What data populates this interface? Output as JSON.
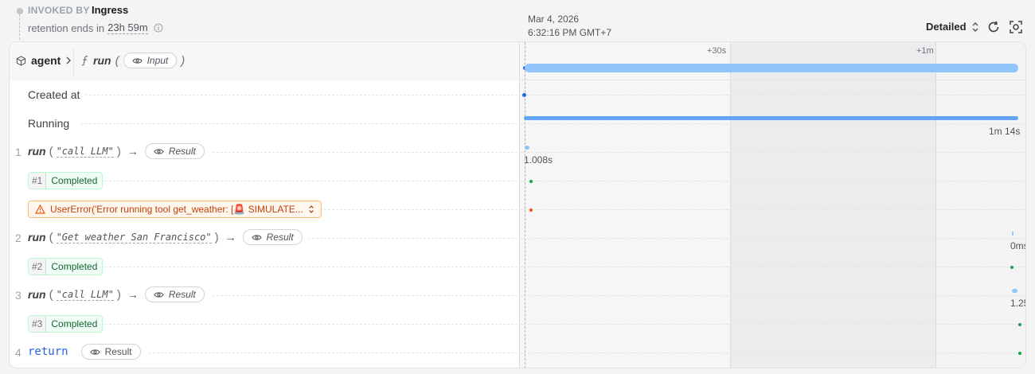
{
  "header": {
    "invoked_label": "INVOKED BY",
    "invoked_value": "Ingress",
    "retention_label": "retention ends in",
    "retention_value": "23h 59m",
    "timestamp_date": "Mar 4, 2026",
    "timestamp_time": "6:32:16 PM GMT+7",
    "view_mode": "Detailed"
  },
  "invocation": {
    "service": "agent",
    "handler": "run",
    "input_label": "Input"
  },
  "timeline": {
    "ticks": [
      "+30s",
      "+1m"
    ],
    "running_duration": "1m 14s"
  },
  "rows": {
    "created_at": "Created at",
    "running": "Running",
    "step1": {
      "num": "1",
      "name": "run",
      "arg": "\"call LLM\"",
      "result": "Result",
      "duration": "1.008s"
    },
    "badge1": {
      "num": "#1",
      "status": "Completed"
    },
    "error": {
      "text": "UserError('Error running tool get_weather: [🚨 SIMULATE..."
    },
    "step2": {
      "num": "2",
      "name": "run",
      "arg": "\"Get weather San Francisco\"",
      "result": "Result",
      "duration": "0ms"
    },
    "badge2": {
      "num": "#2",
      "status": "Completed"
    },
    "step3": {
      "num": "3",
      "name": "run",
      "arg": "\"call LLM\"",
      "result": "Result",
      "duration": "1.25"
    },
    "badge3": {
      "num": "#3",
      "status": "Completed"
    },
    "step4": {
      "num": "4",
      "keyword": "return",
      "result": "Result"
    }
  },
  "colors": {
    "accent_blue": "#60a5fa",
    "success_green": "#16a34a",
    "warning_orange": "#ea580c"
  }
}
